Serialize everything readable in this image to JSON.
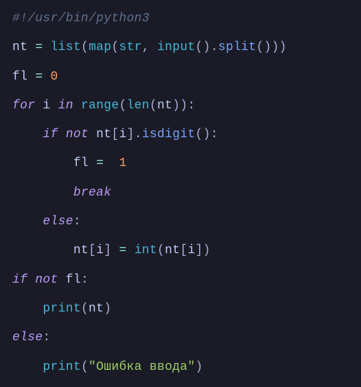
{
  "code": {
    "lines": [
      [
        {
          "t": "#!/usr/bin/python3",
          "c": "c-comment"
        }
      ],
      [
        {
          "t": "nt ",
          "c": "c-ident"
        },
        {
          "t": "=",
          "c": "c-op"
        },
        {
          "t": " ",
          "c": "c-plain"
        },
        {
          "t": "list",
          "c": "c-builtin"
        },
        {
          "t": "(",
          "c": "c-punct"
        },
        {
          "t": "map",
          "c": "c-builtin"
        },
        {
          "t": "(",
          "c": "c-punct"
        },
        {
          "t": "str",
          "c": "c-builtin"
        },
        {
          "t": ",",
          "c": "c-punct"
        },
        {
          "t": " ",
          "c": "c-plain"
        },
        {
          "t": "input",
          "c": "c-builtin"
        },
        {
          "t": "()",
          "c": "c-punct"
        },
        {
          "t": ".",
          "c": "c-punct"
        },
        {
          "t": "split",
          "c": "c-call"
        },
        {
          "t": "()))",
          "c": "c-punct"
        }
      ],
      [
        {
          "t": "fl ",
          "c": "c-ident"
        },
        {
          "t": "=",
          "c": "c-op"
        },
        {
          "t": " ",
          "c": "c-plain"
        },
        {
          "t": "0",
          "c": "c-number"
        }
      ],
      [
        {
          "t": "for",
          "c": "c-flow"
        },
        {
          "t": " i ",
          "c": "c-ident"
        },
        {
          "t": "in",
          "c": "c-flow"
        },
        {
          "t": " ",
          "c": "c-plain"
        },
        {
          "t": "range",
          "c": "c-builtin"
        },
        {
          "t": "(",
          "c": "c-punct"
        },
        {
          "t": "len",
          "c": "c-builtin"
        },
        {
          "t": "(",
          "c": "c-punct"
        },
        {
          "t": "nt",
          "c": "c-ident"
        },
        {
          "t": "))",
          "c": "c-punct"
        },
        {
          "t": ":",
          "c": "c-punct"
        }
      ],
      [
        {
          "t": "    ",
          "c": "c-plain"
        },
        {
          "t": "if",
          "c": "c-flow"
        },
        {
          "t": " ",
          "c": "c-plain"
        },
        {
          "t": "not",
          "c": "c-flow"
        },
        {
          "t": " nt",
          "c": "c-ident"
        },
        {
          "t": "[",
          "c": "c-punct"
        },
        {
          "t": "i",
          "c": "c-ident"
        },
        {
          "t": "]",
          "c": "c-punct"
        },
        {
          "t": ".",
          "c": "c-punct"
        },
        {
          "t": "isdigit",
          "c": "c-call"
        },
        {
          "t": "()",
          "c": "c-punct"
        },
        {
          "t": ":",
          "c": "c-punct"
        }
      ],
      [
        {
          "t": "        fl ",
          "c": "c-ident"
        },
        {
          "t": "=",
          "c": "c-op"
        },
        {
          "t": "  ",
          "c": "c-plain"
        },
        {
          "t": "1",
          "c": "c-number"
        }
      ],
      [
        {
          "t": "        ",
          "c": "c-plain"
        },
        {
          "t": "break",
          "c": "c-flow"
        }
      ],
      [
        {
          "t": "    ",
          "c": "c-plain"
        },
        {
          "t": "else",
          "c": "c-flow"
        },
        {
          "t": ":",
          "c": "c-punct"
        }
      ],
      [
        {
          "t": "        nt",
          "c": "c-ident"
        },
        {
          "t": "[",
          "c": "c-punct"
        },
        {
          "t": "i",
          "c": "c-ident"
        },
        {
          "t": "]",
          "c": "c-punct"
        },
        {
          "t": " ",
          "c": "c-plain"
        },
        {
          "t": "=",
          "c": "c-op"
        },
        {
          "t": " ",
          "c": "c-plain"
        },
        {
          "t": "int",
          "c": "c-builtin"
        },
        {
          "t": "(",
          "c": "c-punct"
        },
        {
          "t": "nt",
          "c": "c-ident"
        },
        {
          "t": "[",
          "c": "c-punct"
        },
        {
          "t": "i",
          "c": "c-ident"
        },
        {
          "t": "])",
          "c": "c-punct"
        }
      ],
      [
        {
          "t": "if",
          "c": "c-flow"
        },
        {
          "t": " ",
          "c": "c-plain"
        },
        {
          "t": "not",
          "c": "c-flow"
        },
        {
          "t": " fl",
          "c": "c-ident"
        },
        {
          "t": ":",
          "c": "c-punct"
        }
      ],
      [
        {
          "t": "    ",
          "c": "c-plain"
        },
        {
          "t": "print",
          "c": "c-builtin"
        },
        {
          "t": "(",
          "c": "c-punct"
        },
        {
          "t": "nt",
          "c": "c-ident"
        },
        {
          "t": ")",
          "c": "c-punct"
        }
      ],
      [
        {
          "t": "else",
          "c": "c-flow"
        },
        {
          "t": ":",
          "c": "c-punct"
        }
      ],
      [
        {
          "t": "    ",
          "c": "c-plain"
        },
        {
          "t": "print",
          "c": "c-builtin"
        },
        {
          "t": "(",
          "c": "c-punct"
        },
        {
          "t": "\"Ошибка ввода\"",
          "c": "c-string"
        },
        {
          "t": ")",
          "c": "c-punct"
        }
      ]
    ]
  }
}
